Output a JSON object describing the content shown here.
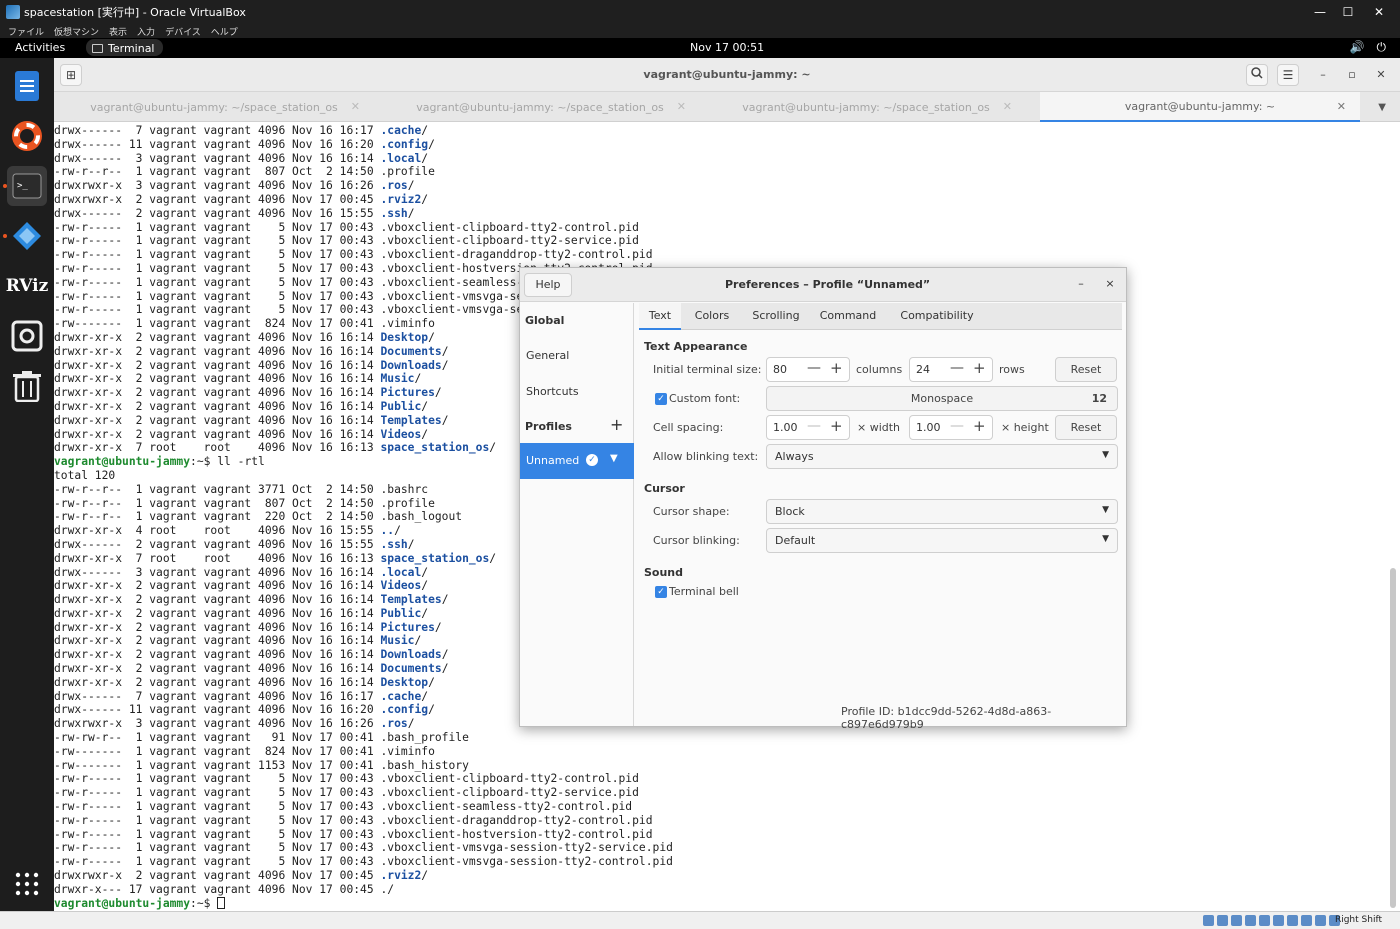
{
  "host": {
    "window_title": "spacestation [実行中] - Oracle VirtualBox",
    "menu": [
      "ファイル",
      "仮想マシン",
      "表示",
      "入力",
      "デバイス",
      "ヘルプ"
    ],
    "minimize": "—",
    "maximize": "☐",
    "close": "✕",
    "host_key": "Right Shift"
  },
  "topbar": {
    "activities": "Activities",
    "app": "Terminal",
    "clock": "Nov 17  00:51"
  },
  "dock": {
    "items": [
      "files-icon",
      "help-icon",
      "terminal-icon",
      "vscode-icon",
      "rviz-icon",
      "screenshot-icon",
      "trash-icon",
      "app-grid-icon"
    ]
  },
  "terminal": {
    "title": "vagrant@ubuntu-jammy: ~",
    "tabs": [
      {
        "label": "vagrant@ubuntu-jammy: ~/space_station_os"
      },
      {
        "label": "vagrant@ubuntu-jammy: ~/space_station_os"
      },
      {
        "label": "vagrant@ubuntu-jammy: ~/space_station_os"
      },
      {
        "label": "vagrant@ubuntu-jammy: ~"
      }
    ],
    "lines": [
      {
        "t": "drwx------  7 vagrant vagrant 4096 Nov 16 16:17 ",
        "d": ".cache",
        "s": "/"
      },
      {
        "t": "drwx------ 11 vagrant vagrant 4096 Nov 16 16:20 ",
        "d": ".config",
        "s": "/"
      },
      {
        "t": "drwx------  3 vagrant vagrant 4096 Nov 16 16:14 ",
        "d": ".local",
        "s": "/"
      },
      {
        "t": "-rw-r--r--  1 vagrant vagrant  807 Oct  2 14:50 .profile"
      },
      {
        "t": "drwxrwxr-x  3 vagrant vagrant 4096 Nov 16 16:26 ",
        "d": ".ros",
        "s": "/"
      },
      {
        "t": "drwxrwxr-x  2 vagrant vagrant 4096 Nov 17 00:45 ",
        "d": ".rviz2",
        "s": "/"
      },
      {
        "t": "drwx------  2 vagrant vagrant 4096 Nov 16 15:55 ",
        "d": ".ssh",
        "s": "/"
      },
      {
        "t": "-rw-r-----  1 vagrant vagrant    5 Nov 17 00:43 .vboxclient-clipboard-tty2-control.pid"
      },
      {
        "t": "-rw-r-----  1 vagrant vagrant    5 Nov 17 00:43 .vboxclient-clipboard-tty2-service.pid"
      },
      {
        "t": "-rw-r-----  1 vagrant vagrant    5 Nov 17 00:43 .vboxclient-draganddrop-tty2-control.pid"
      },
      {
        "t": "-rw-r-----  1 vagrant vagrant    5 Nov 17 00:43 .vboxclient-hostversion-tty2-control.pid"
      },
      {
        "t": "-rw-r-----  1 vagrant vagrant    5 Nov 17 00:43 .vboxclient-seamless-tty2-control.pid"
      },
      {
        "t": "-rw-r-----  1 vagrant vagrant    5 Nov 17 00:43 .vboxclient-vmsvga-session-tty2-service.pid"
      },
      {
        "t": "-rw-r-----  1 vagrant vagrant    5 Nov 17 00:43 .vboxclient-vmsvga-session-tty2-control.pid"
      },
      {
        "t": "-rw-------  1 vagrant vagrant  824 Nov 17 00:41 .viminfo"
      },
      {
        "t": "drwxr-xr-x  2 vagrant vagrant 4096 Nov 16 16:14 ",
        "d": "Desktop",
        "s": "/"
      },
      {
        "t": "drwxr-xr-x  2 vagrant vagrant 4096 Nov 16 16:14 ",
        "d": "Documents",
        "s": "/"
      },
      {
        "t": "drwxr-xr-x  2 vagrant vagrant 4096 Nov 16 16:14 ",
        "d": "Downloads",
        "s": "/"
      },
      {
        "t": "drwxr-xr-x  2 vagrant vagrant 4096 Nov 16 16:14 ",
        "d": "Music",
        "s": "/"
      },
      {
        "t": "drwxr-xr-x  2 vagrant vagrant 4096 Nov 16 16:14 ",
        "d": "Pictures",
        "s": "/"
      },
      {
        "t": "drwxr-xr-x  2 vagrant vagrant 4096 Nov 16 16:14 ",
        "d": "Public",
        "s": "/"
      },
      {
        "t": "drwxr-xr-x  2 vagrant vagrant 4096 Nov 16 16:14 ",
        "d": "Templates",
        "s": "/"
      },
      {
        "t": "drwxr-xr-x  2 vagrant vagrant 4096 Nov 16 16:14 ",
        "d": "Videos",
        "s": "/"
      },
      {
        "t": "drwxr-xr-x  7 root    root    4096 Nov 16 16:13 ",
        "d": "space_station_os",
        "s": "/"
      },
      {
        "p": "vagrant@ubuntu-jammy",
        "t": ":~$ ll -rtl"
      },
      {
        "t": "total 120"
      },
      {
        "t": "-rw-r--r--  1 vagrant vagrant 3771 Oct  2 14:50 .bashrc"
      },
      {
        "t": "-rw-r--r--  1 vagrant vagrant  807 Oct  2 14:50 .profile"
      },
      {
        "t": "-rw-r--r--  1 vagrant vagrant  220 Oct  2 14:50 .bash_logout"
      },
      {
        "t": "drwxr-xr-x  4 root    root    4096 Nov 16 15:55 ",
        "d": "..",
        "s": "/"
      },
      {
        "t": "drwx------  2 vagrant vagrant 4096 Nov 16 15:55 ",
        "d": ".ssh",
        "s": "/"
      },
      {
        "t": "drwxr-xr-x  7 root    root    4096 Nov 16 16:13 ",
        "d": "space_station_os",
        "s": "/"
      },
      {
        "t": "drwx------  3 vagrant vagrant 4096 Nov 16 16:14 ",
        "d": ".local",
        "s": "/"
      },
      {
        "t": "drwxr-xr-x  2 vagrant vagrant 4096 Nov 16 16:14 ",
        "d": "Videos",
        "s": "/"
      },
      {
        "t": "drwxr-xr-x  2 vagrant vagrant 4096 Nov 16 16:14 ",
        "d": "Templates",
        "s": "/"
      },
      {
        "t": "drwxr-xr-x  2 vagrant vagrant 4096 Nov 16 16:14 ",
        "d": "Public",
        "s": "/"
      },
      {
        "t": "drwxr-xr-x  2 vagrant vagrant 4096 Nov 16 16:14 ",
        "d": "Pictures",
        "s": "/"
      },
      {
        "t": "drwxr-xr-x  2 vagrant vagrant 4096 Nov 16 16:14 ",
        "d": "Music",
        "s": "/"
      },
      {
        "t": "drwxr-xr-x  2 vagrant vagrant 4096 Nov 16 16:14 ",
        "d": "Downloads",
        "s": "/"
      },
      {
        "t": "drwxr-xr-x  2 vagrant vagrant 4096 Nov 16 16:14 ",
        "d": "Documents",
        "s": "/"
      },
      {
        "t": "drwxr-xr-x  2 vagrant vagrant 4096 Nov 16 16:14 ",
        "d": "Desktop",
        "s": "/"
      },
      {
        "t": "drwx------  7 vagrant vagrant 4096 Nov 16 16:17 ",
        "d": ".cache",
        "s": "/"
      },
      {
        "t": "drwx------ 11 vagrant vagrant 4096 Nov 16 16:20 ",
        "d": ".config",
        "s": "/"
      },
      {
        "t": "drwxrwxr-x  3 vagrant vagrant 4096 Nov 16 16:26 ",
        "d": ".ros",
        "s": "/"
      },
      {
        "t": "-rw-rw-r--  1 vagrant vagrant   91 Nov 17 00:41 .bash_profile"
      },
      {
        "t": "-rw-------  1 vagrant vagrant  824 Nov 17 00:41 .viminfo"
      },
      {
        "t": "-rw-------  1 vagrant vagrant 1153 Nov 17 00:41 .bash_history"
      },
      {
        "t": "-rw-r-----  1 vagrant vagrant    5 Nov 17 00:43 .vboxclient-clipboard-tty2-control.pid"
      },
      {
        "t": "-rw-r-----  1 vagrant vagrant    5 Nov 17 00:43 .vboxclient-clipboard-tty2-service.pid"
      },
      {
        "t": "-rw-r-----  1 vagrant vagrant    5 Nov 17 00:43 .vboxclient-seamless-tty2-control.pid"
      },
      {
        "t": "-rw-r-----  1 vagrant vagrant    5 Nov 17 00:43 .vboxclient-draganddrop-tty2-control.pid"
      },
      {
        "t": "-rw-r-----  1 vagrant vagrant    5 Nov 17 00:43 .vboxclient-hostversion-tty2-control.pid"
      },
      {
        "t": "-rw-r-----  1 vagrant vagrant    5 Nov 17 00:43 .vboxclient-vmsvga-session-tty2-service.pid"
      },
      {
        "t": "-rw-r-----  1 vagrant vagrant    5 Nov 17 00:43 .vboxclient-vmsvga-session-tty2-control.pid"
      },
      {
        "t": "drwxrwxr-x  2 vagrant vagrant 4096 Nov 17 00:45 ",
        "d": ".rviz2",
        "s": "/"
      },
      {
        "t": "drwxr-x--- 17 vagrant vagrant 4096 Nov 17 00:45 ./"
      },
      {
        "p": "vagrant@ubuntu-jammy",
        "t": ":~$ ",
        "cursor": true
      }
    ]
  },
  "prefs": {
    "help": "Help",
    "title": "Preferences – Profile “Unnamed”",
    "minimize": "–",
    "close": "×",
    "sidebar": {
      "global": "Global",
      "general": "General",
      "shortcuts": "Shortcuts",
      "profiles": "Profiles",
      "add": "+",
      "selected_profile": "Unnamed"
    },
    "tabs": [
      "Text",
      "Colors",
      "Scrolling",
      "Command",
      "Compatibility"
    ],
    "text_appearance": {
      "heading": "Text Appearance",
      "size_label": "Initial terminal size:",
      "columns_value": "80",
      "columns_unit": "columns",
      "rows_value": "24",
      "rows_unit": "rows",
      "reset": "Reset",
      "custom_font_label": "Custom font:",
      "font_name": "Monospace",
      "font_size": "12",
      "spacing_label": "Cell spacing:",
      "width_value": "1.00",
      "width_unit": "× width",
      "height_value": "1.00",
      "height_unit": "× height",
      "blink_label": "Allow blinking text:",
      "blink_value": "Always"
    },
    "cursor": {
      "heading": "Cursor",
      "shape_label": "Cursor shape:",
      "shape_value": "Block",
      "blinking_label": "Cursor blinking:",
      "blinking_value": "Default"
    },
    "sound": {
      "heading": "Sound",
      "bell_label": "Terminal bell"
    },
    "profile_id": "Profile ID: b1dcc9dd-5262-4d8d-a863-c897e6d979b9"
  },
  "colors": {
    "accent": "#3584e4",
    "dir": "#1b4fa0",
    "prompt": "#1d8a2e"
  }
}
